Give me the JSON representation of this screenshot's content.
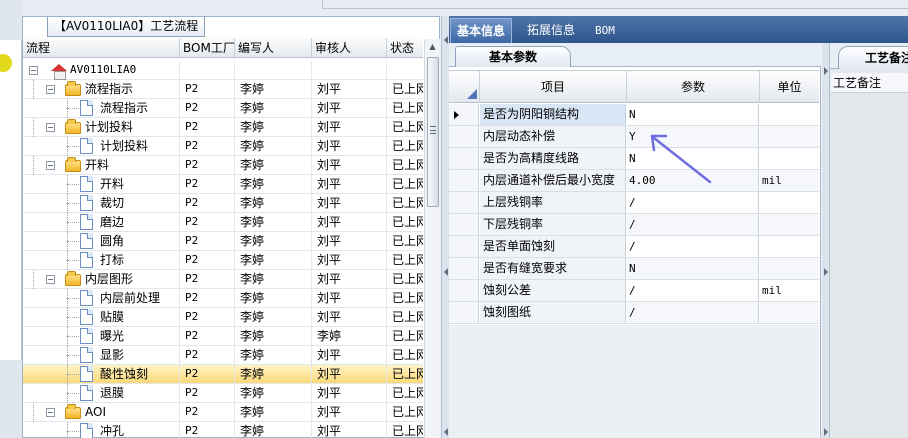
{
  "left_panel": {
    "title": "【AV0110LIA0】工艺流程",
    "columns": [
      "流程",
      "BOM工厂",
      "编写人",
      "审核人",
      "状态"
    ],
    "rows": [
      {
        "name": "AV0110LIA0",
        "level": 0,
        "icon": "home-icon",
        "expander": "−",
        "bom": "",
        "writer": "",
        "reviewer": "",
        "status": ""
      },
      {
        "name": "流程指示",
        "level": 1,
        "icon": "folder-icon",
        "expander": "−",
        "bom": "P2",
        "writer": "李婷",
        "reviewer": "刘平",
        "status": "已上网"
      },
      {
        "name": "流程指示",
        "level": 2,
        "icon": "document-icon",
        "expander": "",
        "bom": "P2",
        "writer": "李婷",
        "reviewer": "刘平",
        "status": "已上网"
      },
      {
        "name": "计划投料",
        "level": 1,
        "icon": "folder-icon",
        "expander": "−",
        "bom": "P2",
        "writer": "李婷",
        "reviewer": "刘平",
        "status": "已上网"
      },
      {
        "name": "计划投料",
        "level": 2,
        "icon": "document-icon",
        "expander": "",
        "bom": "P2",
        "writer": "李婷",
        "reviewer": "刘平",
        "status": "已上网"
      },
      {
        "name": "开料",
        "level": 1,
        "icon": "folder-icon",
        "expander": "−",
        "bom": "P2",
        "writer": "李婷",
        "reviewer": "刘平",
        "status": "已上网"
      },
      {
        "name": "开料",
        "level": 2,
        "icon": "document-icon",
        "expander": "",
        "bom": "P2",
        "writer": "李婷",
        "reviewer": "刘平",
        "status": "已上网"
      },
      {
        "name": "裁切",
        "level": 2,
        "icon": "document-icon",
        "expander": "",
        "bom": "P2",
        "writer": "李婷",
        "reviewer": "刘平",
        "status": "已上网"
      },
      {
        "name": "磨边",
        "level": 2,
        "icon": "document-icon",
        "expander": "",
        "bom": "P2",
        "writer": "李婷",
        "reviewer": "刘平",
        "status": "已上网"
      },
      {
        "name": "圆角",
        "level": 2,
        "icon": "document-icon",
        "expander": "",
        "bom": "P2",
        "writer": "李婷",
        "reviewer": "刘平",
        "status": "已上网"
      },
      {
        "name": "打标",
        "level": 2,
        "icon": "document-icon",
        "expander": "",
        "bom": "P2",
        "writer": "李婷",
        "reviewer": "刘平",
        "status": "已上网"
      },
      {
        "name": "内层图形",
        "level": 1,
        "icon": "folder-icon",
        "expander": "−",
        "bom": "P2",
        "writer": "李婷",
        "reviewer": "刘平",
        "status": "已上网"
      },
      {
        "name": "内层前处理",
        "level": 2,
        "icon": "document-icon",
        "expander": "",
        "bom": "P2",
        "writer": "李婷",
        "reviewer": "刘平",
        "status": "已上网"
      },
      {
        "name": "贴膜",
        "level": 2,
        "icon": "document-icon",
        "expander": "",
        "bom": "P2",
        "writer": "李婷",
        "reviewer": "刘平",
        "status": "已上网"
      },
      {
        "name": "曝光",
        "level": 2,
        "icon": "document-icon",
        "expander": "",
        "bom": "P2",
        "writer": "李婷",
        "reviewer": "李婷",
        "status": "已上网"
      },
      {
        "name": "显影",
        "level": 2,
        "icon": "document-icon",
        "expander": "",
        "bom": "P2",
        "writer": "李婷",
        "reviewer": "刘平",
        "status": "已上网"
      },
      {
        "name": "酸性蚀刻",
        "level": 2,
        "icon": "document-icon",
        "expander": "",
        "bom": "P2",
        "writer": "李婷",
        "reviewer": "刘平",
        "status": "已上网",
        "selected": true
      },
      {
        "name": "退膜",
        "level": 2,
        "icon": "document-icon",
        "expander": "",
        "bom": "P2",
        "writer": "李婷",
        "reviewer": "刘平",
        "status": "已上网"
      },
      {
        "name": "AOI",
        "level": 1,
        "icon": "folder-icon",
        "expander": "−",
        "bom": "P2",
        "writer": "李婷",
        "reviewer": "刘平",
        "status": "已上网"
      },
      {
        "name": "冲孔",
        "level": 2,
        "icon": "document-icon",
        "expander": "",
        "bom": "P2",
        "writer": "李婷",
        "reviewer": "刘平",
        "status": "已上网"
      }
    ]
  },
  "tabs": [
    {
      "label": "基本信息",
      "active": true
    },
    {
      "label": "拓展信息",
      "active": false
    },
    {
      "label": "BOM",
      "active": false
    }
  ],
  "center_panel": {
    "title": "基本参数",
    "columns": {
      "item": "项目",
      "param": "参数",
      "unit": "单位"
    },
    "rows": [
      {
        "item": "是否为阴阳铜结构",
        "param": "N",
        "unit": "",
        "current": true
      },
      {
        "item": "内层动态补偿",
        "param": "Y",
        "unit": ""
      },
      {
        "item": "是否为高精度线路",
        "param": "N",
        "unit": ""
      },
      {
        "item": "内层通道补偿后最小宽度",
        "param": "4.00",
        "unit": "mil"
      },
      {
        "item": "上层残铜率",
        "param": "/",
        "unit": ""
      },
      {
        "item": "下层残铜率",
        "param": "/",
        "unit": ""
      },
      {
        "item": "是否单面蚀刻",
        "param": "/",
        "unit": ""
      },
      {
        "item": "是否有缝宽要求",
        "param": "N",
        "unit": ""
      },
      {
        "item": "蚀刻公差",
        "param": "/",
        "unit": "mil"
      },
      {
        "item": "蚀刻图纸",
        "param": "/",
        "unit": ""
      }
    ]
  },
  "remark_panel": {
    "title": "工艺备注",
    "label": "工艺备注"
  },
  "colors": {
    "tab_bar": "#3a6399",
    "selected_row": "#fbd879",
    "annotation_arrow": "#6e6ee0",
    "indicator": "#e3da1e"
  }
}
